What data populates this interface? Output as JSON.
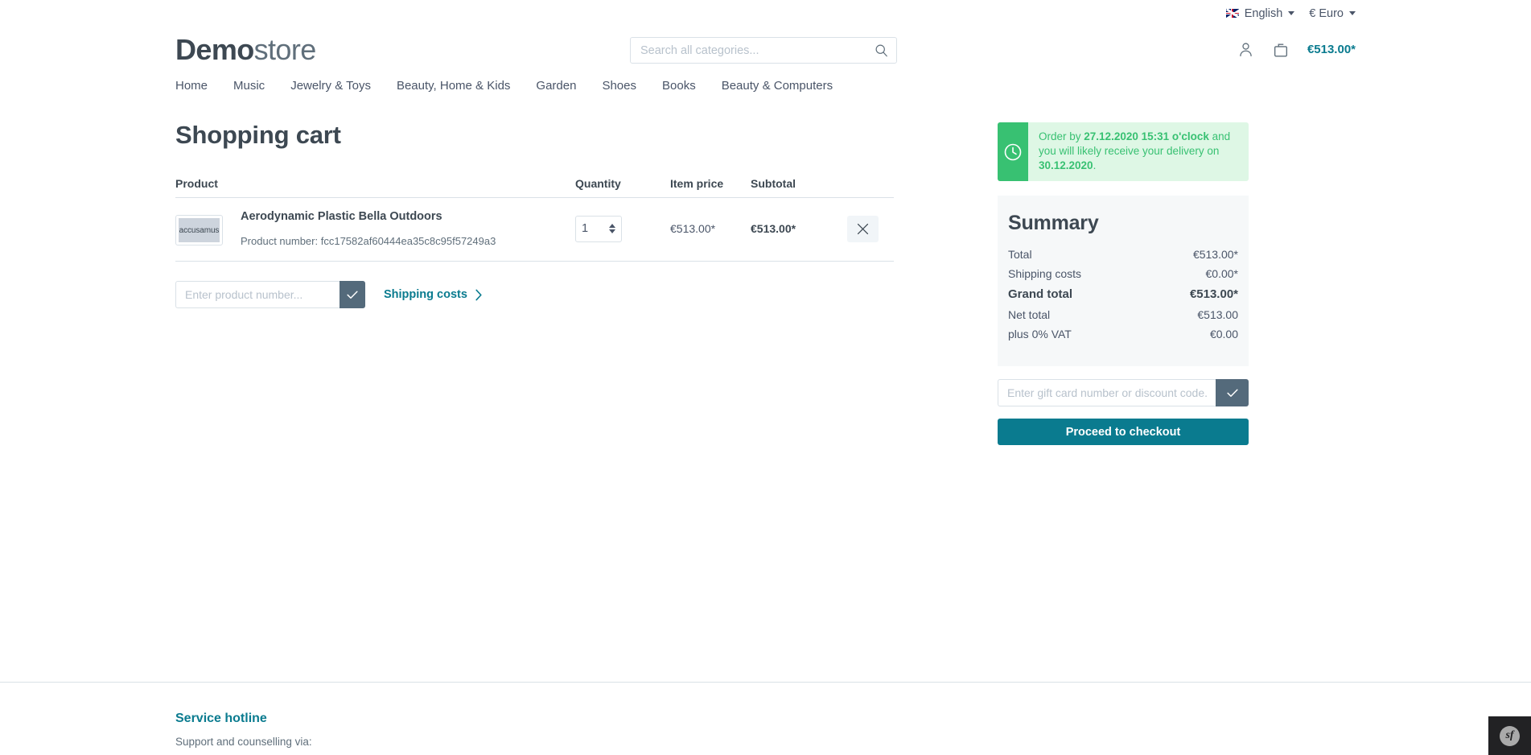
{
  "topbar": {
    "language": "English",
    "language_icon": "uk-flag-icon",
    "currency": "€ Euro",
    "caret_icon": "chevron-down-icon"
  },
  "header": {
    "logo_bold": "Demo",
    "logo_light": "store",
    "search_placeholder": "Search all categories...",
    "search_value": "",
    "search_icon": "search-icon",
    "account_icon": "user-account-icon",
    "cart_icon": "shopping-bag-icon",
    "cart_total": "€513.00*"
  },
  "nav": {
    "items": [
      {
        "label": "Home"
      },
      {
        "label": "Music"
      },
      {
        "label": "Jewelry & Toys"
      },
      {
        "label": "Beauty, Home & Kids"
      },
      {
        "label": "Garden"
      },
      {
        "label": "Shoes"
      },
      {
        "label": "Books"
      },
      {
        "label": "Beauty & Computers"
      }
    ]
  },
  "main": {
    "title": "Shopping cart",
    "table_headers": {
      "product": "Product",
      "quantity": "Quantity",
      "item_price": "Item price",
      "subtotal": "Subtotal"
    },
    "rows": [
      {
        "thumb_label": "accusamus",
        "name": "Aerodynamic Plastic Bella Outdoors",
        "product_number_label": "Product number:",
        "product_number": "fcc17582af60444ea35c8c95f57249a3",
        "quantity": "1",
        "item_price": "€513.00*",
        "subtotal": "€513.00*",
        "remove_icon": "close-x-icon"
      }
    ],
    "product_number_placeholder": "Enter product number...",
    "product_number_value": "",
    "product_number_submit_icon": "checkmark-icon",
    "shipping_costs_link": "Shipping costs",
    "shipping_costs_chevron_icon": "chevron-right-icon"
  },
  "sidebar": {
    "notice": {
      "icon": "clock-icon",
      "prefix": "Order by ",
      "deadline": "27.12.2020 15:31 o'clock",
      "middle": " and you will likely receive your delivery on ",
      "delivery_date": "30.12.2020",
      "suffix": "."
    },
    "summary": {
      "title": "Summary",
      "rows": [
        {
          "label": "Total",
          "value": "€513.00*",
          "bold": false
        },
        {
          "label": "Shipping costs",
          "value": "€0.00*",
          "bold": false
        },
        {
          "label": "Grand total",
          "value": "€513.00*",
          "bold": true
        },
        {
          "label": "Net total",
          "value": "€513.00",
          "bold": false
        },
        {
          "label": "plus 0% VAT",
          "value": "€0.00",
          "bold": false
        }
      ]
    },
    "gift_placeholder": "Enter gift card number or discount code...",
    "gift_value": "",
    "gift_submit_icon": "checkmark-icon",
    "checkout_label": "Proceed to checkout"
  },
  "footer": {
    "hotline_title": "Service hotline",
    "hotline_text": "Support and counselling via:"
  },
  "debug_toolbar": {
    "badge": "sf"
  },
  "colors": {
    "accent": "#0a7b8f",
    "notice_green": "#38c172",
    "notice_bg": "#def7e5",
    "text": "#4a5568",
    "heading": "#3d4852",
    "border": "#dae1e7",
    "summary_bg": "#f6f8f9",
    "button_slate": "#546a7b"
  }
}
